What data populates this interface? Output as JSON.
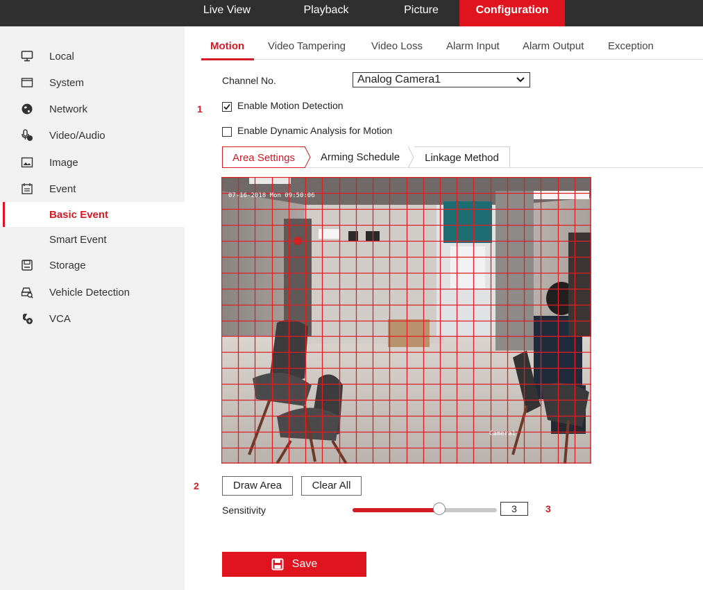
{
  "topnav": {
    "items": [
      {
        "label": "Live View"
      },
      {
        "label": "Playback"
      },
      {
        "label": "Picture"
      },
      {
        "label": "Configuration"
      }
    ]
  },
  "sidebar": {
    "items": [
      {
        "label": "Local",
        "icon": "monitor-icon"
      },
      {
        "label": "System",
        "icon": "window-icon"
      },
      {
        "label": "Network",
        "icon": "globe-icon"
      },
      {
        "label": "Video/Audio",
        "icon": "microphone-icon"
      },
      {
        "label": "Image",
        "icon": "image-icon"
      },
      {
        "label": "Event",
        "icon": "calendar-icon"
      },
      {
        "label": "Basic Event"
      },
      {
        "label": "Smart Event"
      },
      {
        "label": "Storage",
        "icon": "disk-icon"
      },
      {
        "label": "Vehicle Detection",
        "icon": "vehicle-icon"
      },
      {
        "label": "VCA",
        "icon": "vca-icon"
      }
    ]
  },
  "tabs": [
    {
      "label": "Motion"
    },
    {
      "label": "Video Tampering"
    },
    {
      "label": "Video Loss"
    },
    {
      "label": "Alarm Input"
    },
    {
      "label": "Alarm Output"
    },
    {
      "label": "Exception"
    }
  ],
  "channel": {
    "label": "Channel No.",
    "value": "Analog Camera1"
  },
  "steps": {
    "one": "1",
    "two": "2",
    "three": "3"
  },
  "enable_motion": {
    "label": "Enable Motion Detection",
    "checked": true
  },
  "enable_dynamic": {
    "label": "Enable Dynamic Analysis for Motion",
    "checked": false
  },
  "subtabs": [
    {
      "label": "Area Settings"
    },
    {
      "label": "Arming Schedule"
    },
    {
      "label": "Linkage Method"
    }
  ],
  "video": {
    "timestamp": "07-16-2018 Mon 09:50:06",
    "camera_name": "Camera1",
    "grid_color": "#e01e24"
  },
  "buttons": {
    "draw_area": "Draw Area",
    "clear_all": "Clear All",
    "save": "Save"
  },
  "sensitivity": {
    "label": "Sensitivity",
    "value": "3",
    "level": 0.6
  },
  "colors": {
    "accent": "#e0141e",
    "topbar": "#2f2f2f",
    "sidebar": "#f1f1f1"
  }
}
